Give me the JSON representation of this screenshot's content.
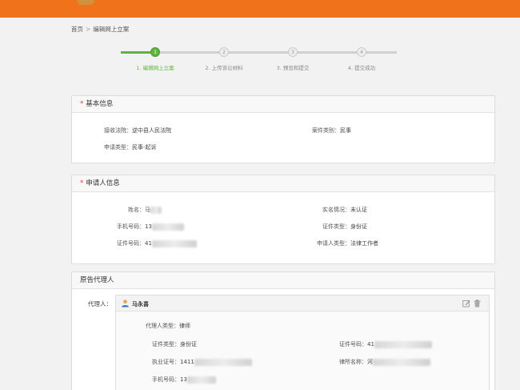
{
  "colors": {
    "brand": "#f0731c",
    "success": "#5fb53b",
    "required": "#e03c2a"
  },
  "breadcrumb": {
    "home": "首页",
    "separator": ">",
    "current": "编辑网上立案"
  },
  "steps": [
    {
      "number": "1",
      "label": "1. 编辑网上立案",
      "state": "active"
    },
    {
      "number": "2",
      "label": "2. 上传诉讼材料",
      "state": "idle"
    },
    {
      "number": "3",
      "label": "3. 预览和提交",
      "state": "idle"
    },
    {
      "number": "4",
      "label": "4. 提交成功",
      "state": "idle"
    }
  ],
  "basic_info": {
    "required_mark": "*",
    "title": "基本信息",
    "court_label": "接收法院：",
    "court_value": "逆中县人民法院",
    "case_type_label": "案件类别：",
    "case_type_value": "民事",
    "apply_type_label": "申请类型：",
    "apply_type_value": "民事-起诉"
  },
  "applicant": {
    "required_mark": "*",
    "title": "申请人信息",
    "name_label": "姓名：",
    "name_value": "马",
    "realname_label": "实名情况：",
    "realname_value": "未认证",
    "phone_label": "手机号码：",
    "phone_value": "13",
    "id_type_label": "证件类型：",
    "id_type_value": "身份证",
    "id_no_label": "证件号码：",
    "id_no_value": "41",
    "applicant_type_label": "申请人类型：",
    "applicant_type_value": "法律工作者"
  },
  "plaintiff_agent": {
    "title": "原告代理人",
    "agent_label": "代理人：",
    "agent_name": "马永喜",
    "agent_type_label": "代理人类型：",
    "agent_type_value": "律师",
    "id_type_label": "证件类型：",
    "id_type_value": "身份证",
    "id_no_label": "证件号码：",
    "id_no_value": "41",
    "license_label": "执业证号：",
    "license_value": "1411",
    "firm_label": "律所名称：",
    "firm_value": "河",
    "phone_label": "手机号码：",
    "phone_value": "13",
    "icons": {
      "user": "user-icon",
      "edit": "edit-icon",
      "delete": "trash-icon"
    }
  }
}
